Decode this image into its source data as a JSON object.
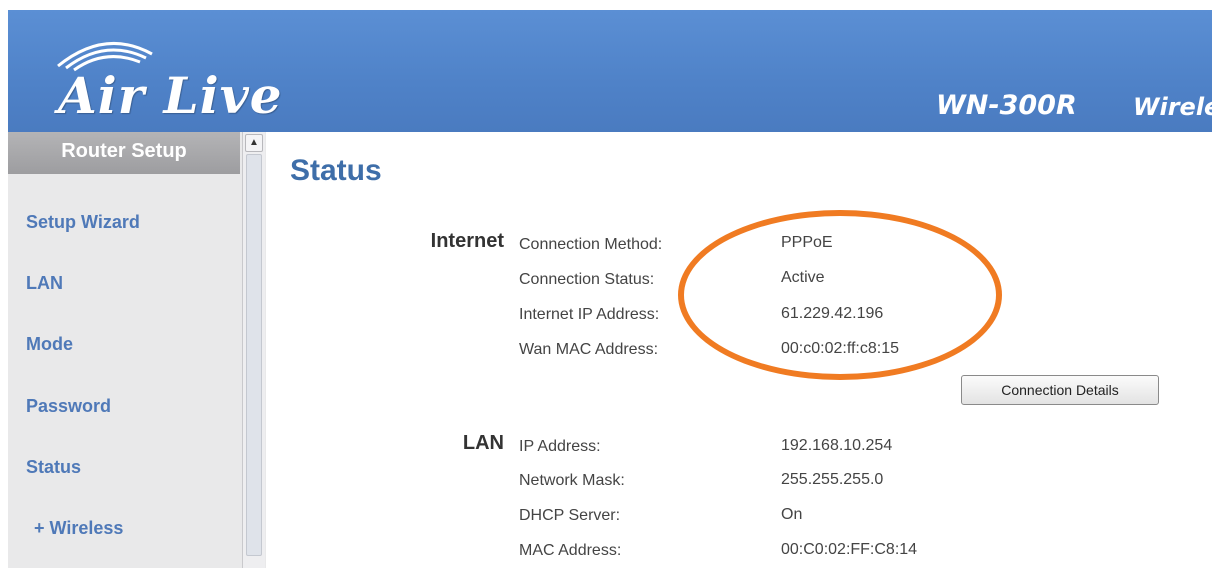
{
  "header": {
    "logo_text": "Air Live",
    "model": "WN-300R",
    "product": "Wirele"
  },
  "sidebar": {
    "title": "Router Setup",
    "items": [
      {
        "label": "Setup Wizard"
      },
      {
        "label": "LAN"
      },
      {
        "label": "Mode"
      },
      {
        "label": "Password"
      },
      {
        "label": "Status"
      },
      {
        "label": "+ Wireless"
      }
    ]
  },
  "main": {
    "title": "Status",
    "internet": {
      "heading": "Internet",
      "rows": [
        {
          "label": "Connection Method:",
          "value": "PPPoE"
        },
        {
          "label": "Connection Status:",
          "value": "Active"
        },
        {
          "label": "Internet IP Address:",
          "value": "61.229.42.196"
        },
        {
          "label": "Wan MAC Address:",
          "value": "00:c0:02:ff:c8:15"
        }
      ],
      "button_label": "Connection Details"
    },
    "lan": {
      "heading": "LAN",
      "rows": [
        {
          "label": "IP Address:",
          "value": "192.168.10.254"
        },
        {
          "label": "Network Mask:",
          "value": "255.255.255.0"
        },
        {
          "label": "DHCP Server:",
          "value": "On"
        },
        {
          "label": "MAC Address:",
          "value": "00:C0:02:FF:C8:14"
        }
      ]
    }
  },
  "colors": {
    "header_blue": "#4f82c8",
    "title_blue": "#3e6ea9",
    "nav_link": "#4f79b8",
    "highlight_orange": "#f07b22"
  }
}
